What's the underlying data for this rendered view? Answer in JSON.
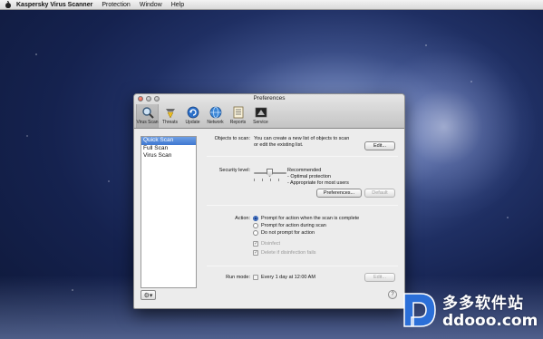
{
  "menubar": {
    "app_name": "Kaspersky Virus Scanner",
    "items": [
      "Protection",
      "Window",
      "Help"
    ]
  },
  "window": {
    "title": "Preferences",
    "tabs": [
      {
        "label": "Virus Scan",
        "icon": "magnifier-icon"
      },
      {
        "label": "Threats",
        "icon": "threats-icon"
      },
      {
        "label": "Update",
        "icon": "update-icon"
      },
      {
        "label": "Network",
        "icon": "network-icon"
      },
      {
        "label": "Reports",
        "icon": "reports-icon"
      },
      {
        "label": "Service",
        "icon": "service-icon"
      }
    ],
    "active_tab": "Virus Scan"
  },
  "scan_list": {
    "items": [
      "Quick Scan",
      "Full Scan",
      "Virus Scan"
    ],
    "selected": "Quick Scan"
  },
  "objects": {
    "label": "Objects to scan:",
    "description_line1": "You can create a new list of objects to scan",
    "description_line2": "or edit the existing list.",
    "edit_button": "Edit..."
  },
  "security": {
    "label": "Security level:",
    "level_name": "Recommended",
    "bullet1": "- Optimal protection",
    "bullet2": "- Appropriate for most users",
    "preferences_button": "Preferences...",
    "default_button": "Default"
  },
  "action": {
    "label": "Action:",
    "options": [
      "Prompt for action when the scan is complete",
      "Prompt for action during scan",
      "Do not prompt for action"
    ],
    "selected_index": 0,
    "disinfect_label": "Disinfect",
    "delete_label": "Delete if disinfection fails"
  },
  "run_mode": {
    "label": "Run mode:",
    "schedule_label": "Every 1 day at 12:00 AM",
    "edit_button": "Edit..."
  },
  "help_symbol": "?",
  "gear_symbol": "⚙▾",
  "watermark": {
    "chinese_text": "多多软件站",
    "url_text": "ddooo.com"
  }
}
